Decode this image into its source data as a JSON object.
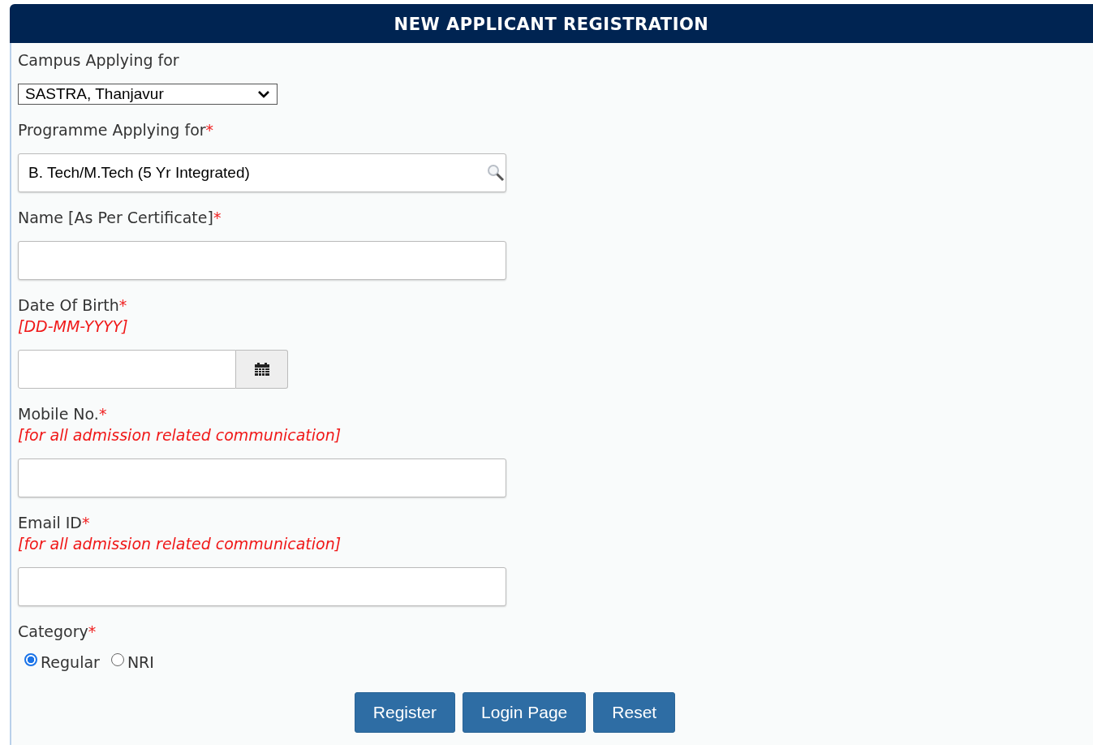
{
  "title": "NEW APPLICANT REGISTRATION",
  "fields": [
    {
      "kind": "select",
      "label": "Campus Applying for",
      "value": "SASTRA, Thanjavur"
    },
    {
      "kind": "lookup",
      "label": "Programme Applying for",
      "mark": "*",
      "value": "B. Tech/M.Tech (5 Yr Integrated)"
    },
    {
      "kind": "text",
      "label": "Name [As Per Certificate]",
      "mark": "*"
    },
    {
      "kind": "date",
      "label": "Date Of Birth",
      "mark": "*",
      "hint": "[DD-MM-YYYY]"
    },
    {
      "kind": "text",
      "label": "Mobile No.",
      "mark": "*",
      "hint": "[for all admission related communication]"
    },
    {
      "kind": "text",
      "label": "Email ID",
      "mark": "*",
      "hint": "[for all admission related communication]"
    },
    {
      "kind": "radio",
      "label": "Category",
      "mark": "*",
      "options": [
        {
          "label": "Regular",
          "selected": true
        },
        {
          "label": "NRI",
          "selected": false
        }
      ]
    }
  ],
  "buttons": [
    "Register",
    "Login Page",
    "Reset"
  ]
}
